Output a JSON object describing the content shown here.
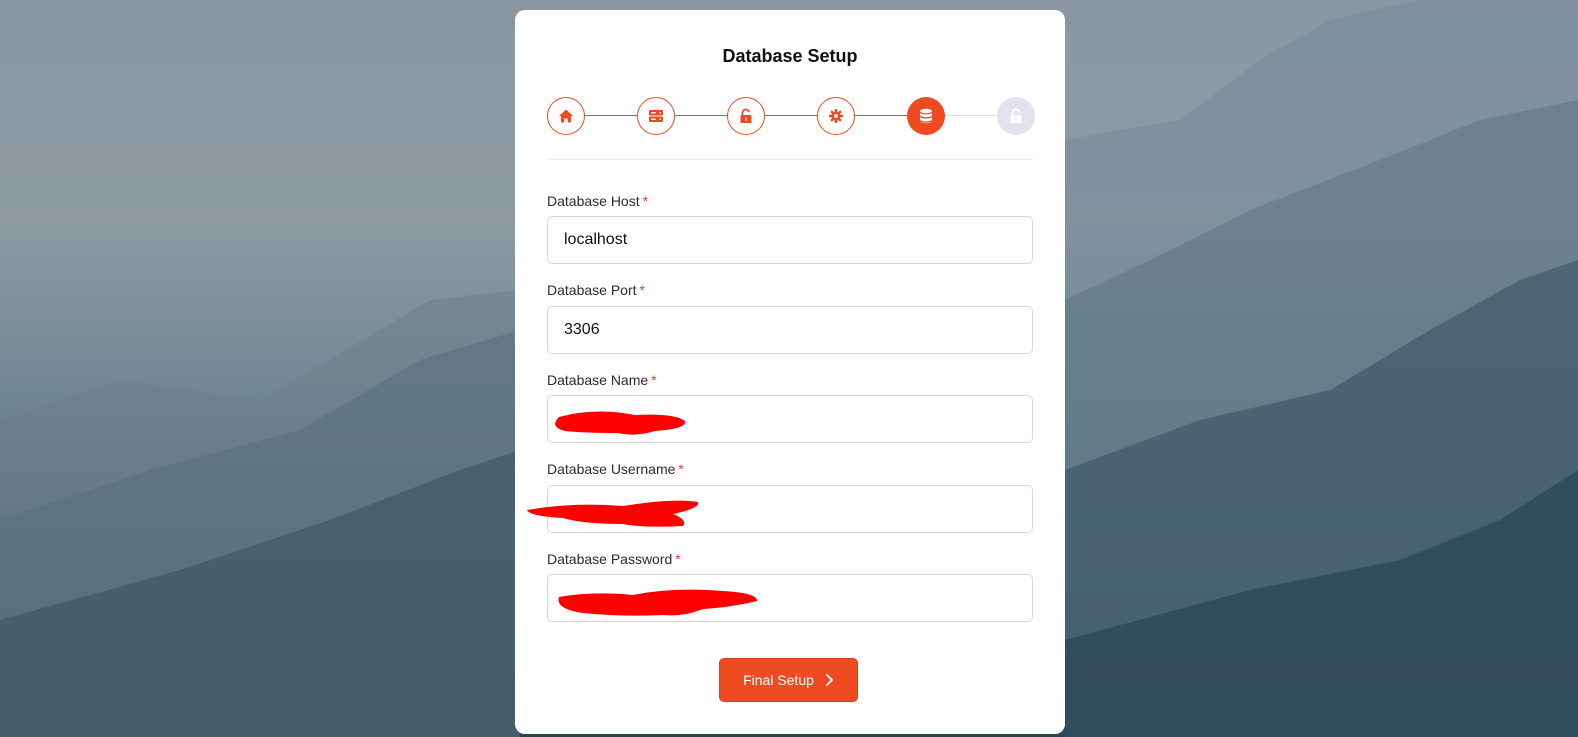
{
  "page": {
    "title": "Database Setup"
  },
  "stepper": {
    "accent": "#ee4b22",
    "inactive": "#e3e3ee",
    "steps": [
      {
        "icon": "home-icon",
        "state": "done"
      },
      {
        "icon": "server-icon",
        "state": "done"
      },
      {
        "icon": "unlock-icon",
        "state": "done"
      },
      {
        "icon": "gear-icon",
        "state": "done"
      },
      {
        "icon": "database-icon",
        "state": "active"
      },
      {
        "icon": "unlock-icon",
        "state": "todo"
      }
    ]
  },
  "form": {
    "host": {
      "label": "Database Host",
      "required": "*",
      "value": "localhost"
    },
    "port": {
      "label": "Database Port",
      "required": "*",
      "value": "3306"
    },
    "name": {
      "label": "Database Name",
      "required": "*",
      "value": ""
    },
    "username": {
      "label": "Database Username",
      "required": "*",
      "value": ""
    },
    "password": {
      "label": "Database Password",
      "required": "*",
      "value": ""
    }
  },
  "actions": {
    "submit_label": "Final Setup",
    "submit_icon": "chevron-right-icon"
  }
}
